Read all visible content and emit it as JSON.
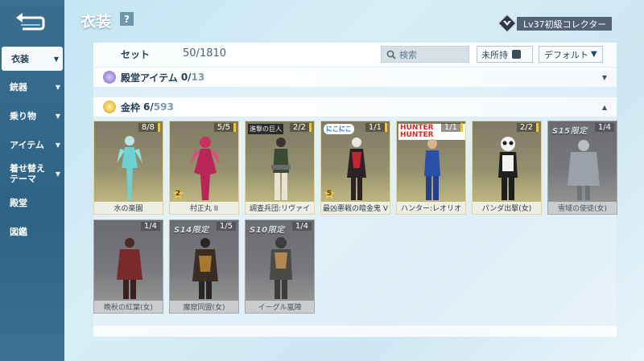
{
  "header": {
    "title": "衣装",
    "help_label": "?",
    "rank_text": "Lv37初級コレクター"
  },
  "sidebar": {
    "items": [
      {
        "label": "衣装",
        "active": true
      },
      {
        "label": "銃器"
      },
      {
        "label": "乗り物"
      },
      {
        "label": "アイテム"
      },
      {
        "label": "着せ替えテーマ"
      },
      {
        "label": "殿堂"
      },
      {
        "label": "図鑑"
      }
    ]
  },
  "toolbar": {
    "set_label": "セット",
    "set_count": "50/1810",
    "search_placeholder": "検索",
    "unowned_label": "未所持",
    "sort_label": "デフォルト"
  },
  "sections": [
    {
      "name": "殿堂アイテム",
      "owned": "0/",
      "total": "13",
      "expanded": false,
      "color": "#9b83d6"
    },
    {
      "name": "金枠",
      "owned": "6/",
      "total": "593",
      "expanded": true,
      "color": "#e4b93a"
    }
  ],
  "cards": [
    {
      "name": "水の楽園",
      "count": "8/8"
    },
    {
      "name": "村正丸 II",
      "count": "5/5",
      "level": "2"
    },
    {
      "name": "調査兵団:リヴァイ",
      "count": "2/2",
      "logo": "進撃の巨人"
    },
    {
      "name": "最凶悪戦の暗金鬼 V",
      "count": "1/1",
      "level": "5",
      "logo": "にこにこ"
    },
    {
      "name": "ハンター:レオリオ",
      "count": "1/1",
      "logo": "HUNTER HUNTER"
    },
    {
      "name": "パンダ出撃(女)",
      "count": "2/2"
    },
    {
      "name": "雪域の使徒(女)",
      "count": "1/4",
      "season": "S15限定"
    },
    {
      "name": "晩秋の紅葉(女)",
      "count": "1/4"
    },
    {
      "name": "魔窟同盟(女)",
      "count": "1/5",
      "season": "S14限定"
    },
    {
      "name": "イーグル嵐陣",
      "count": "1/4",
      "season": "S10限定"
    }
  ],
  "colors": {
    "accent": "#e7c64d",
    "sidebar": "#2f6386",
    "owned_card": "#96916f",
    "unowned_card": "#787a7e"
  }
}
